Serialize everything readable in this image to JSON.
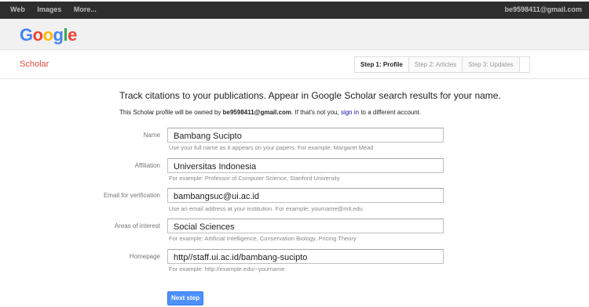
{
  "topbar": {
    "links": [
      "Web",
      "Images",
      "More..."
    ],
    "account": "be9598411@gmail.com"
  },
  "header": {
    "logo": [
      "G",
      "o",
      "o",
      "g",
      "l",
      "e"
    ]
  },
  "scholar": {
    "label": "Scholar",
    "steps": [
      {
        "label": "Step 1: Profile",
        "active": true
      },
      {
        "label": "Step 2: Articles",
        "active": false
      },
      {
        "label": "Step 3: Updates",
        "active": false
      }
    ]
  },
  "main": {
    "intro": "Track citations to your publications. Appear in Google Scholar search results for your name.",
    "owner_pre": "This Scholar profile will be owned by",
    "owner_email": "be9598411@gmail.com",
    "owner_mid": ". If that's not you,",
    "owner_link": "sign in",
    "owner_post": "to a different account."
  },
  "form": {
    "name": {
      "label": "Name",
      "value": "Bambang Sucipto",
      "hint": "Use your full name as it appears on your papers. For example: Margaret Mead"
    },
    "affiliation": {
      "label": "Affiliation",
      "value": "Universitas Indonesia",
      "hint": "For example: Professor of Computer Science, Stanford University"
    },
    "email": {
      "label": "Email for verification",
      "value": "bambangsuc@ui.ac.id",
      "hint": "Use an email address at your institution. For example: yourname@mit.edu"
    },
    "interests": {
      "label": "Areas of interest",
      "value": "Social Sciences",
      "hint": "For example: Artificial Intelligence, Conservation Biology, Pricing Theory"
    },
    "homepage": {
      "label": "Homepage",
      "value": "http//staff.ui.ac.id/bambang-sucipto",
      "hint": "For example: http://example.edu/~yourname"
    }
  },
  "actions": {
    "next_label": "Next step"
  },
  "colors": {
    "accent": "#4d90fe",
    "scholar_red": "#dd4b39",
    "topbar": "#2d2d2d"
  }
}
